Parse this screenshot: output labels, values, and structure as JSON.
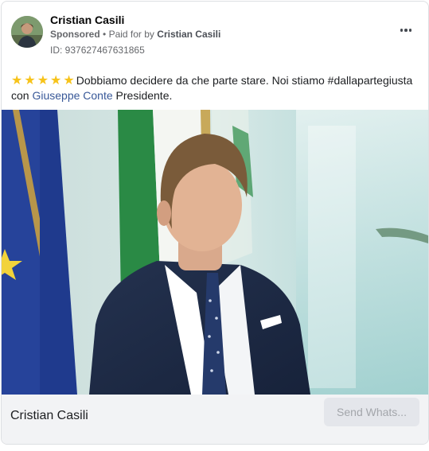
{
  "ad": {
    "advertiser_name": "Cristian Casili",
    "sponsored_label": "Sponsored",
    "separator": "•",
    "paid_for_prefix": "Paid for by",
    "payer_name": "Cristian Casili",
    "ad_id": "ID: 937627467631865",
    "more_options_icon": "more-horizontal-icon"
  },
  "post": {
    "stars": [
      "★",
      "★",
      "★",
      "★",
      "★"
    ],
    "star_color": "#f7c31a",
    "text_part1": "Dobbiamo decidere da che parte stare. Noi stiamo #dallapartegiusta con",
    "mention": "Giuseppe Conte",
    "text_part2": "Presidente.",
    "mention_color": "#385898"
  },
  "footer": {
    "page_name": "Cristian Casili",
    "cta_label": "Send Whats..."
  },
  "colors": {
    "footer_bg": "#f2f3f5",
    "cta_bg": "#e4e6eb",
    "cta_text": "#a3a6ab"
  }
}
